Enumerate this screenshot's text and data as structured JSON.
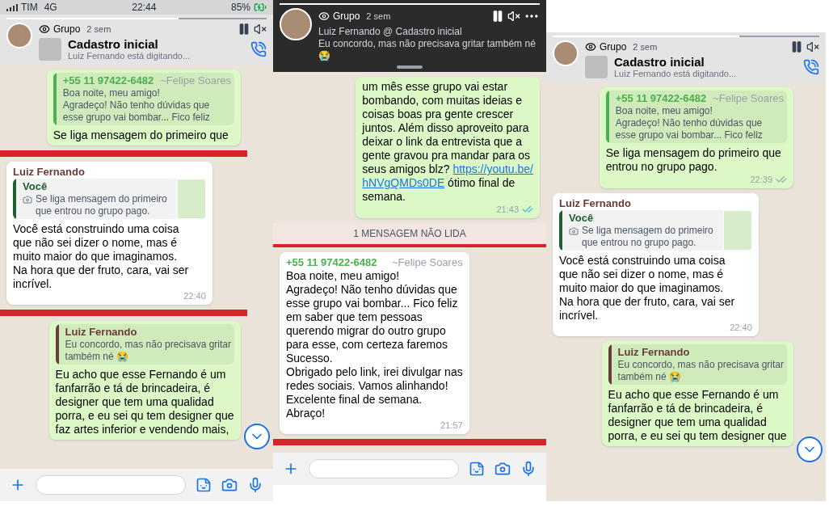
{
  "panels": [
    {
      "status_bar": {
        "carrier": "TIM",
        "network": "4G",
        "time": "22:44",
        "battery": "85%"
      },
      "story": {
        "label": "Grupo",
        "age": "2 sem",
        "level": 0.66
      },
      "header": {
        "kind": "chat",
        "title": "Cadastro inicial",
        "subtitle": "Luiz Fernando  está digitando..."
      },
      "messages": [
        {
          "kind": "outgoing",
          "quote": {
            "author": "+55 11 97422-6482",
            "alias": "~Felipe Soares",
            "color": "#4caf50",
            "lines": [
              "Boa noite, meu amigo!",
              "Agradeço! Não tenho dúvidas que",
              "esse grupo vai bombar... Fico feliz"
            ]
          },
          "lines": [
            "Se liga mensagem do primeiro que"
          ]
        },
        {
          "kind": "stripe"
        },
        {
          "kind": "incoming",
          "sender": "Luiz Fernando",
          "color": "#6b3a3a",
          "quote": {
            "author": "Você",
            "color": "#1f5e2e",
            "photo": true,
            "thumbnail": true,
            "lines": [
              "Se liga mensagem do primeiro",
              "que entrou no grupo pago."
            ]
          },
          "lines": [
            "Você está construindo uma coisa",
            "que não sei dizer o nome, mas é",
            "muito maior do que imaginamos.",
            "Na hora que der fruto, cara, vai ser",
            "incrível."
          ],
          "time": "22:40"
        },
        {
          "kind": "stripe"
        },
        {
          "kind": "outgoing",
          "quote": {
            "author": "Luiz Fernando",
            "color": "#6b3a3a",
            "lines": [
              "Eu concordo, mas não precisava gritar",
              "também né 😭"
            ]
          },
          "lines": [
            "Eu acho que esse Fernando é um",
            "fanfarrão e tá de brincadeira, é",
            "designer que tem uma qualidad",
            "porra, e eu sei qu tem designer que",
            "faz artes inferior e vendendo mais,"
          ]
        }
      ],
      "scroll_button": true,
      "input_bar": true
    },
    {
      "story": {
        "label": "Grupo",
        "age": "2 sem",
        "level": 1
      },
      "header": {
        "kind": "notification",
        "title": "Luiz Fernando  @ Cadastro inicial",
        "subtitle": "Eu concordo, mas não precisava gritar também né 😭"
      },
      "messages": [
        {
          "kind": "outgoing",
          "lines": [
            "um mês esse grupo vai estar",
            "bombando, com muitas ideias e",
            "coisas boas pra gente crescer",
            "juntos. Além disso aproveito para",
            "deixar o link da entrevista que a",
            "gente gravou pra mandar para os",
            [
              {
                "text": "seus amigos blz? "
              },
              {
                "text": "https://youtu.be/",
                "link": true
              }
            ],
            [
              {
                "text": "hNVgQMDs0DE",
                "link": true
              },
              {
                "text": " ótimo final de"
              }
            ],
            "semana."
          ],
          "time": "21:43",
          "read": true
        },
        {
          "kind": "unread_divider",
          "text": "1 MENSAGEM NÃO LIDA"
        },
        {
          "kind": "incoming",
          "sender": "+55 11 97422-6482",
          "color": "#4caf50",
          "alias": "~Felipe Soares",
          "lines": [
            "Boa noite, meu amigo!",
            "Agradeço! Não tenho dúvidas que",
            "esse grupo vai bombar... Fico feliz",
            "em saber que tem pessoas",
            "querendo migrar do outro grupo",
            "para esse, com certeza faremos",
            "Sucesso.",
            "Obrigado pelo link, irei divulgar nas",
            "redes sociais. Vamos alinhando!",
            "Excelente final de semana.",
            "Abraço!"
          ],
          "time": "21:57"
        },
        {
          "kind": "stripe"
        }
      ],
      "scroll_button": false,
      "input_bar": true
    },
    {
      "story": {
        "label": "Grupo",
        "age": "2 sem",
        "level": 0.7
      },
      "header": {
        "kind": "chat",
        "title": "Cadastro inicial",
        "subtitle": "Luiz Fernando  está digitando..."
      },
      "messages": [
        {
          "kind": "outgoing",
          "quote": {
            "author": "+55 11 97422-6482",
            "alias": "~Felipe Soares",
            "color": "#4caf50",
            "lines": [
              "Boa noite, meu amigo!",
              "Agradeço! Não tenho dúvidas que",
              "esse grupo vai bombar... Fico feliz"
            ]
          },
          "lines": [
            "Se liga mensagem do primeiro que",
            "entrou no grupo pago."
          ],
          "time": "22:39",
          "read": false
        },
        {
          "kind": "incoming",
          "sender": "Luiz Fernando",
          "color": "#6b3a3a",
          "quote": {
            "author": "Você",
            "color": "#1f5e2e",
            "photo": true,
            "thumbnail": true,
            "lines": [
              "Se liga mensagem do primeiro",
              "que entrou no grupo pago."
            ]
          },
          "lines": [
            "Você está construindo uma coisa",
            "que não sei dizer o nome, mas é",
            "muito maior do que imaginamos.",
            "Na hora que der fruto, cara, vai ser",
            "incrível."
          ],
          "time": "22:40"
        },
        {
          "kind": "outgoing",
          "quote": {
            "author": "Luiz Fernando",
            "color": "#6b3a3a",
            "lines": [
              "Eu concordo, mas não precisava gritar",
              "também né 😭"
            ]
          },
          "lines": [
            "Eu acho que esse Fernando é um",
            "fanfarrão e tá de brincadeira, é",
            "designer que tem uma qualidad",
            "porra, e eu sei qu tem designer que"
          ]
        }
      ],
      "scroll_button": true,
      "input_bar": false
    }
  ]
}
